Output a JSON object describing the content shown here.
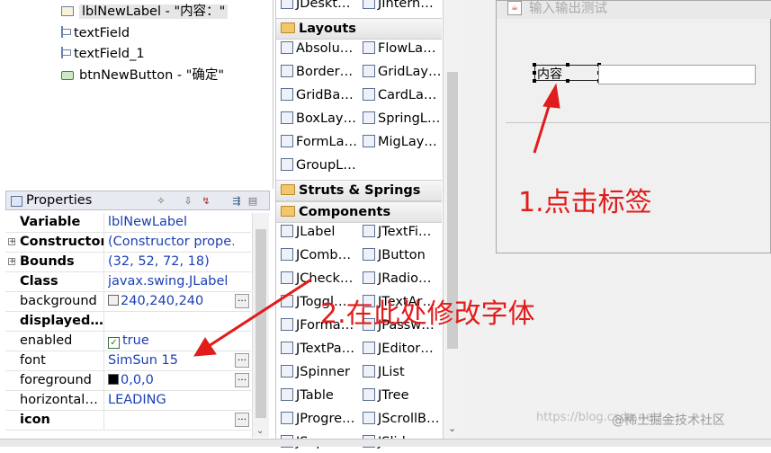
{
  "tree": {
    "items": [
      {
        "label": "lblNewLabel - \"内容：\"",
        "icon": "label-icon",
        "selected": true
      },
      {
        "label": "textField",
        "icon": "textfield-icon"
      },
      {
        "label": "textField_1",
        "icon": "textfield-icon"
      },
      {
        "label": "btnNewButton - \"确定\"",
        "icon": "button-icon"
      }
    ]
  },
  "properties": {
    "title": "Properties",
    "rows": [
      {
        "name": "Variable",
        "value": "lblNewLabel",
        "bold": true
      },
      {
        "name": "Constructor",
        "value": "(Constructor prope…",
        "bold": true,
        "expandable": true
      },
      {
        "name": "Bounds",
        "value": "(32, 52, 72, 18)",
        "bold": true,
        "expandable": true
      },
      {
        "name": "Class",
        "value": "javax.swing.JLabel",
        "bold": true
      },
      {
        "name": "background",
        "value": "240,240,240",
        "swatch": "#f0f0f0",
        "button": true
      },
      {
        "name": "displayed…",
        "value": "",
        "bold": true
      },
      {
        "name": "enabled",
        "value": "true",
        "checkbox": true
      },
      {
        "name": "font",
        "value": "SimSun 15",
        "button": true
      },
      {
        "name": "foreground",
        "value": "0,0,0",
        "swatch": "#000000",
        "button": true
      },
      {
        "name": "horizontal…",
        "value": "LEADING"
      },
      {
        "name": "icon",
        "value": "",
        "bold": true,
        "button": true
      }
    ]
  },
  "palette": {
    "rows": [
      {
        "type": "item",
        "left": "JDeskt…",
        "right": "JIntern…"
      },
      {
        "type": "category",
        "label": "Layouts"
      },
      {
        "type": "item",
        "left": "Absolu…",
        "right": "FlowLa…"
      },
      {
        "type": "item",
        "left": "Border…",
        "right": "GridLay…"
      },
      {
        "type": "item",
        "left": "GridBa…",
        "right": "CardLa…"
      },
      {
        "type": "item",
        "left": "BoxLay…",
        "right": "SpringL…"
      },
      {
        "type": "item",
        "left": "FormLa…",
        "right": "MigLay…"
      },
      {
        "type": "item",
        "left": "GroupL…",
        "right": ""
      },
      {
        "type": "category",
        "label": "Struts & Springs"
      },
      {
        "type": "category",
        "label": "Components"
      },
      {
        "type": "item",
        "left": "JLabel",
        "right": "JTextFi…"
      },
      {
        "type": "item",
        "left": "JComb…",
        "right": "JButton"
      },
      {
        "type": "item",
        "left": "JCheck…",
        "right": "JRadio…"
      },
      {
        "type": "item",
        "left": "JToggl…",
        "right": "JTextAr…"
      },
      {
        "type": "item",
        "left": "JForma…",
        "right": "JPassw…"
      },
      {
        "type": "item",
        "left": "JTextPa…",
        "right": "JEditor…"
      },
      {
        "type": "item",
        "left": "JSpinner",
        "right": "JList"
      },
      {
        "type": "item",
        "left": "JTable",
        "right": "JTree"
      },
      {
        "type": "item",
        "left": "JProgre…",
        "right": "JScrollB…"
      },
      {
        "type": "item",
        "left": "JSepara…",
        "right": "JSlider"
      }
    ]
  },
  "design": {
    "frame_title": "输入输出测试",
    "label_text": "内容"
  },
  "annotations": {
    "step1": "1.点击标签",
    "step2": "2.在此处修改字体"
  },
  "footer": {
    "watermark": "https://blog.csdn.net/...",
    "brand": "@稀土掘金技术社区"
  },
  "colors": {
    "annotation": "#e21b1b",
    "value_text": "#1b3fb5"
  }
}
